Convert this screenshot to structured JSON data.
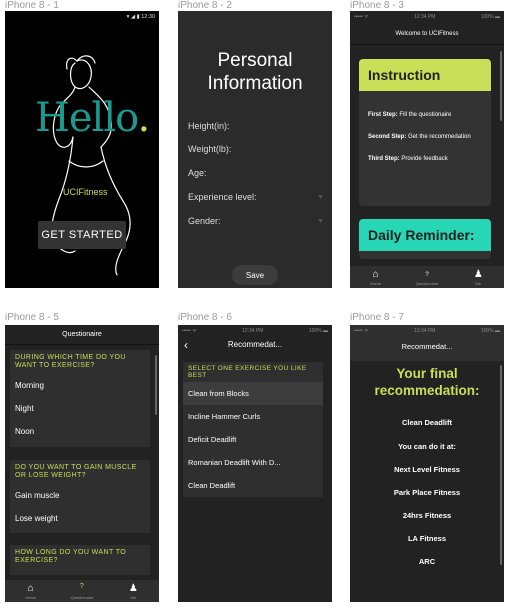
{
  "artboards": [
    {
      "label": "iPhone 8 - 1"
    },
    {
      "label": "iPhone 8 - 2"
    },
    {
      "label": "iPhone 8 - 3"
    },
    {
      "label": "iPhone 8 - 5"
    },
    {
      "label": "iPhone 8 - 6"
    },
    {
      "label": "iPhone 8 - 7"
    }
  ],
  "colors": {
    "accent_lime": "#c9df57",
    "accent_teal": "#26d6b5",
    "hello_teal": "#1a9a8e",
    "bg_dark": "#2b2b2b"
  },
  "screen1": {
    "status_time": "12:30",
    "hello": "Hello",
    "hello_dot": ".",
    "brand": "UCIFitness",
    "start_button": "GET STARTED"
  },
  "screen2": {
    "title": "Personal Information",
    "fields": [
      "Height(in):",
      "Weight(lb):",
      "Age:",
      "Experience level:",
      "Gender:"
    ],
    "save_button": "Save"
  },
  "screen3": {
    "status_left": "••••• ᯤ",
    "status_time": "12:34 PM",
    "status_right": "100% ▬",
    "header": "Welcome to UCIFitness",
    "instruction_title": "Instruction",
    "steps": [
      {
        "bold": "First Step:",
        "text": " Fill the questionaire"
      },
      {
        "bold": "Second Step:",
        "text": " Get the recommedation"
      },
      {
        "bold": "Third Step:",
        "text": " Provide feedback"
      }
    ],
    "reminder_title": "Daily Reminder:",
    "tabs": [
      {
        "icon": "home-icon",
        "label": "Home"
      },
      {
        "icon": "question-icon",
        "label": "Questionaire"
      },
      {
        "icon": "person-icon",
        "label": "Me"
      }
    ]
  },
  "screen5": {
    "header": "Questionaire",
    "q1": "DURING WHICH TIME DO YOU WANT TO EXERCISE?",
    "q1_options": [
      "Morning",
      "Night",
      "Noon"
    ],
    "q2": "DO YOU WANT TO GAIN MUSCLE OR LOSE WEIGHT?",
    "q2_options": [
      "Gain muscle",
      "Lose weight"
    ],
    "q3": "HOW LONG DO YOU WANT TO EXERCISE?",
    "tabs": [
      {
        "icon": "home-icon",
        "label": "Home"
      },
      {
        "icon": "question-icon",
        "label": "Questionaire"
      },
      {
        "icon": "person-icon",
        "label": "Me"
      }
    ]
  },
  "screen6": {
    "status_left": "••••• ᯤ",
    "status_time": "12:34 PM",
    "status_right": "100% ▬",
    "title": "Recommedat...",
    "prompt": "SELECT ONE EXERCISE YOU LIKE BEST",
    "items": [
      "Clean from Blocks",
      "Incline Hammer Curls",
      "Deficit Deadlift",
      "Romanian Deadlift With D...",
      "Clean Deadlift"
    ]
  },
  "screen7": {
    "status_left": "••••• ᯤ",
    "status_time": "12:34 PM",
    "status_right": "100% ▬",
    "title": "Recommedat...",
    "final_title": "Your final recommedation:",
    "exercise": "Clean Deadlift",
    "do_it_at": "You can do it at:",
    "places": [
      "Next Level Fitness",
      "Park Place Fitness",
      "24hrs Fitness",
      "LA Fitness",
      "ARC"
    ]
  }
}
